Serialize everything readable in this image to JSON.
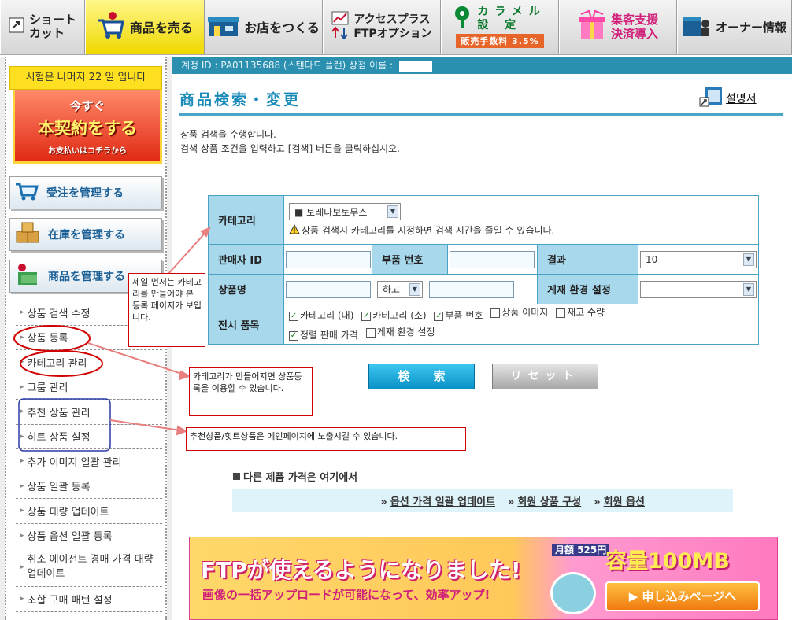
{
  "topnav": {
    "shortcut_line1": "ショート",
    "shortcut_line2": "カット",
    "sell": "商品を売る",
    "shop": "お店をつくる",
    "ftp_line1": "アクセスプラス",
    "ftp_line2": "FTPオプション",
    "caramel_line1": "カラメル",
    "caramel_line2": "設  定",
    "caramel_fee": "販売手数料 3.5%",
    "support_line1": "集客支援",
    "support_line2": "決済導入",
    "owner": "オーナー情報"
  },
  "sidebar": {
    "trial_text": "시험은 나머지 22 일 입니다",
    "contract_line1": "今すぐ",
    "contract_line2": "本契約をする",
    "contract_line3": "お支払いはコチラから",
    "order_btn": "受注を管理する",
    "stock_btn": "在庫を管理する",
    "product_btn": "商品を管理する",
    "submenu": [
      "상품 검색 수정",
      "상품 등록",
      "카테고리 관리",
      "그룹 관리",
      "추천 상품 관리",
      "히트 상품 설정",
      "추가 이미지 일괄 관리",
      "상품 일괄 등록",
      "상품 대량 업데이트",
      "상품 옵션 일괄 등록",
      "취소 에이전트 경매 가격 대량 업데이트",
      "조합 구매 패턴 설정"
    ]
  },
  "account": {
    "label": "계정 ID : PA01135688 (스탠다드 플랜)  상점 이름 :"
  },
  "page": {
    "title": "商品検索・変更",
    "manual": "설명서",
    "desc_line1": "상품 검색을 수행합니다.",
    "desc_line2": "검색 상품 조건을 입력하고 [검색] 버튼을 클릭하십시오."
  },
  "form": {
    "category_label": "카테고리",
    "category_value": "■ 토레나보토무스",
    "category_warning": "상품 검색시 카테고리를 지정하면 검색 시간을 줄일 수 있습니다.",
    "seller_id_label": "판매자 ID",
    "part_no_label": "부품 번호",
    "result_label": "결과",
    "result_value": "10",
    "product_name_label": "상품명",
    "and_value": "하고",
    "listing_env_label": "게재 환경 설정",
    "listing_env_value": "--------",
    "display_items_label": "전시 품목",
    "checks": [
      {
        "label": "카테고리 (대)",
        "checked": "✓"
      },
      {
        "label": "카테고리 (소)",
        "checked": "✓"
      },
      {
        "label": "부품 번호",
        "checked": "✓"
      },
      {
        "label": "상품 이미지",
        "checked": ""
      },
      {
        "label": "재고 수량",
        "checked": ""
      },
      {
        "label": "정렬 판매 가격",
        "checked": "✓"
      },
      {
        "label": "게재 환경 설정",
        "checked": ""
      }
    ]
  },
  "buttons": {
    "search": "検索",
    "reset": "リセット"
  },
  "other_prices": {
    "title": "다른 제품 가격은 여기에서",
    "links": [
      "옵션 가격 일괄 업데이트",
      "회원 상품 구성",
      "회원 옵션"
    ]
  },
  "banner": {
    "main": "FTPが使えるようになりました!",
    "sub": "画像の一括アップロードが可能になって、効率アップ!",
    "price_label": "月額 525円",
    "capacity": "容量100MB",
    "cta": "▶ 申し込みページへ"
  },
  "annotations": {
    "note1": "제일 먼저는 카테고리를 만들어야 본 등록 페이지가 보입니다.",
    "note2": "카테고리가 만들어지면 상품등록을 이용할 수 있습니다.",
    "note3": "추천상품/힛트상품은 메인페이지에 노출시킬 수 있습니다."
  },
  "colors": {
    "accent": "#1a8ab8",
    "form_label_bg": "#a8d8ec",
    "annotation": "#d00000"
  }
}
